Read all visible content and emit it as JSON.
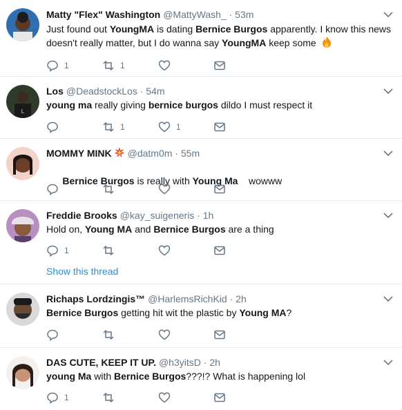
{
  "colors": {
    "accent": "#1b95e0",
    "muted": "#657786",
    "text": "#14171a",
    "divider": "#e6ecf0"
  },
  "tweets": [
    {
      "name": "Matty \"Flex\" Washington",
      "handle": "@MattyWash_",
      "sep": "·",
      "time": "53m",
      "text_parts": [
        {
          "t": "Just found out ",
          "b": false
        },
        {
          "t": "YoungMA",
          "b": true
        },
        {
          "t": " is dating ",
          "b": false
        },
        {
          "t": "Bernice Burgos",
          "b": true
        },
        {
          "t": " apparently. I know this news doesn't really matter, but I do wanna say ",
          "b": false
        },
        {
          "t": "YoungMA",
          "b": true
        },
        {
          "t": " keep some ",
          "b": false
        }
      ],
      "emoji": "fire-icon",
      "counts": {
        "reply": "1",
        "retweet": "1",
        "like": ""
      }
    },
    {
      "name": "Los",
      "handle": "@DeadstockLos",
      "sep": "·",
      "time": "54m",
      "text_parts": [
        {
          "t": "young ma",
          "b": true
        },
        {
          "t": " really giving ",
          "b": false
        },
        {
          "t": "bernice burgos",
          "b": true
        },
        {
          "t": " dildo I must respect it",
          "b": false
        }
      ],
      "counts": {
        "reply": "",
        "retweet": "1",
        "like": "1"
      }
    },
    {
      "name": "MOMMY MINK",
      "name_badge": "collision-icon",
      "handle": "@datm0m",
      "sep": "·",
      "time": "55m",
      "text_parts": [
        {
          "t": "Bernice Burgos",
          "b": true
        },
        {
          "t": " is really with ",
          "b": false
        },
        {
          "t": "Young Ma",
          "b": true
        },
        {
          "t": "    wowww",
          "b": false
        }
      ],
      "counts": {
        "reply": "",
        "retweet": "",
        "like": ""
      }
    },
    {
      "name": "Freddie Brooks",
      "handle": "@kay_suigeneris",
      "sep": "·",
      "time": "1h",
      "text_parts": [
        {
          "t": "Hold on, ",
          "b": false
        },
        {
          "t": "Young MA",
          "b": true
        },
        {
          "t": " and ",
          "b": false
        },
        {
          "t": "Bernice Burgos",
          "b": true
        },
        {
          "t": " are a thing",
          "b": false
        }
      ],
      "counts": {
        "reply": "1",
        "retweet": "",
        "like": ""
      },
      "thread_link": "Show this thread"
    },
    {
      "name": "Richaps Lordzingis™",
      "handle": "@HarlemsRichKid",
      "sep": "·",
      "time": "2h",
      "text_parts": [
        {
          "t": "Bernice Burgos",
          "b": true
        },
        {
          "t": " getting hit wit the plastic by ",
          "b": false
        },
        {
          "t": "Young MA",
          "b": true
        },
        {
          "t": "?",
          "b": false
        }
      ],
      "counts": {
        "reply": "",
        "retweet": "",
        "like": ""
      }
    },
    {
      "name": "DAS CUTE, KEEP IT UP.",
      "handle": "@h3yitsD",
      "sep": "·",
      "time": "2h",
      "text_parts": [
        {
          "t": "young Ma",
          "b": true
        },
        {
          "t": " with ",
          "b": false
        },
        {
          "t": "Bernice Burgos",
          "b": true
        },
        {
          "t": "???!? What is happening lol",
          "b": false
        }
      ],
      "counts": {
        "reply": "1",
        "retweet": "",
        "like": ""
      }
    }
  ]
}
